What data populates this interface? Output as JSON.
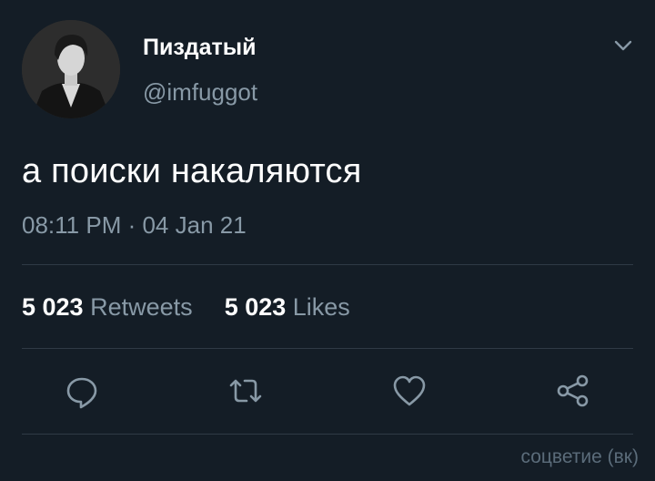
{
  "tweet": {
    "display_name": "Пиздатый",
    "handle": "@imfuggot",
    "text": "а поиски накаляются",
    "timestamp": "08:11 PM · 04 Jan 21"
  },
  "stats": {
    "retweets_count": "5 023",
    "retweets_label": "Retweets",
    "likes_count": "5 023",
    "likes_label": "Likes"
  },
  "actions": [
    "reply-icon",
    "retweet-icon",
    "like-icon",
    "share-icon"
  ],
  "watermark": "соцветие (вк)",
  "colors": {
    "background": "#141d26",
    "text_primary": "#ffffff",
    "text_secondary": "#8899a6",
    "divider": "#2f3a45"
  }
}
